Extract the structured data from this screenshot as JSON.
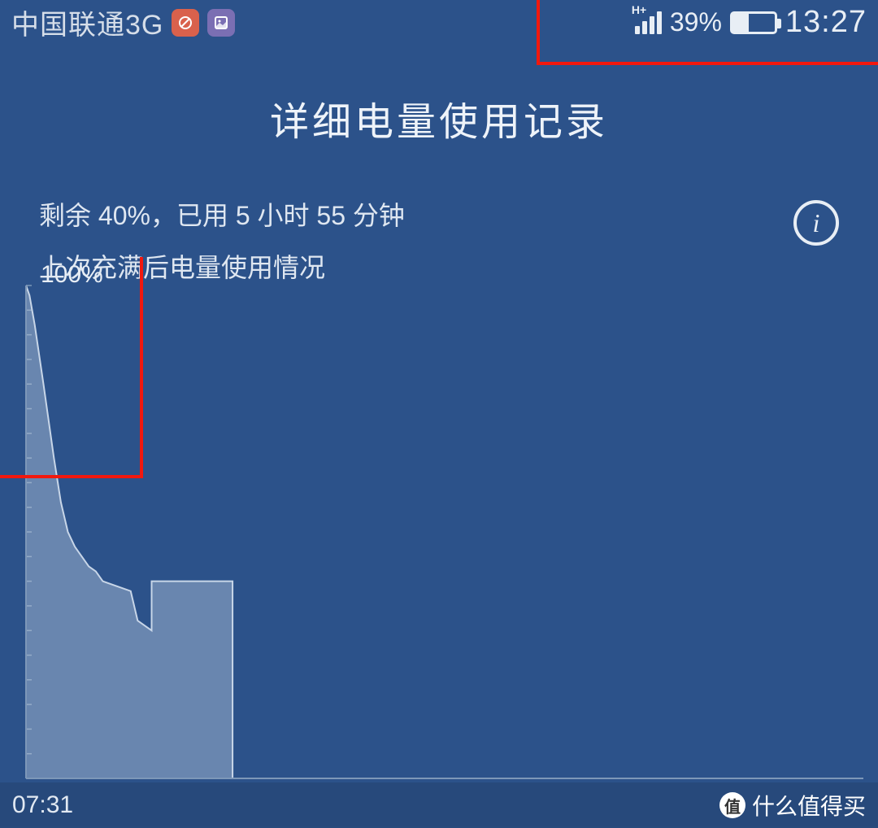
{
  "status": {
    "carrier": "中国联通3G",
    "network_type": "H+",
    "battery_percent_text": "39%",
    "battery_percent": 39,
    "time": "13:27"
  },
  "title": "详细电量使用记录",
  "summary": "剩余  40%，已用 5 小时 55 分钟",
  "subheading": "上次充满后电量使用情况",
  "info_icon_label": "i",
  "chart_data": {
    "type": "area",
    "ylabel_top": "100%",
    "ylim": [
      0,
      100
    ],
    "x_unit": "hours",
    "x_range": [
      0,
      24
    ],
    "data_max_hours": 5.92,
    "series": [
      {
        "name": "battery",
        "x": [
          0,
          0.1,
          0.25,
          0.5,
          0.8,
          1.0,
          1.2,
          1.4,
          1.6,
          1.8,
          2.0,
          2.2,
          2.6,
          3.0,
          3.2,
          3.6,
          3.6,
          5.92,
          5.92
        ],
        "values": [
          100,
          98,
          92,
          80,
          65,
          56,
          50,
          47,
          45,
          43,
          42,
          40,
          39,
          38,
          32,
          30,
          40,
          40,
          0
        ]
      }
    ]
  },
  "bottom": {
    "start_time": "07:31"
  },
  "watermark": {
    "text": "什么值得买",
    "icon": "值"
  },
  "colors": {
    "bg": "#2c528a",
    "highlight": "#f2180e",
    "axis": "#7d97b8",
    "area_fill": "rgba(180,198,219,0.45)",
    "line": "#c8d6e8"
  }
}
